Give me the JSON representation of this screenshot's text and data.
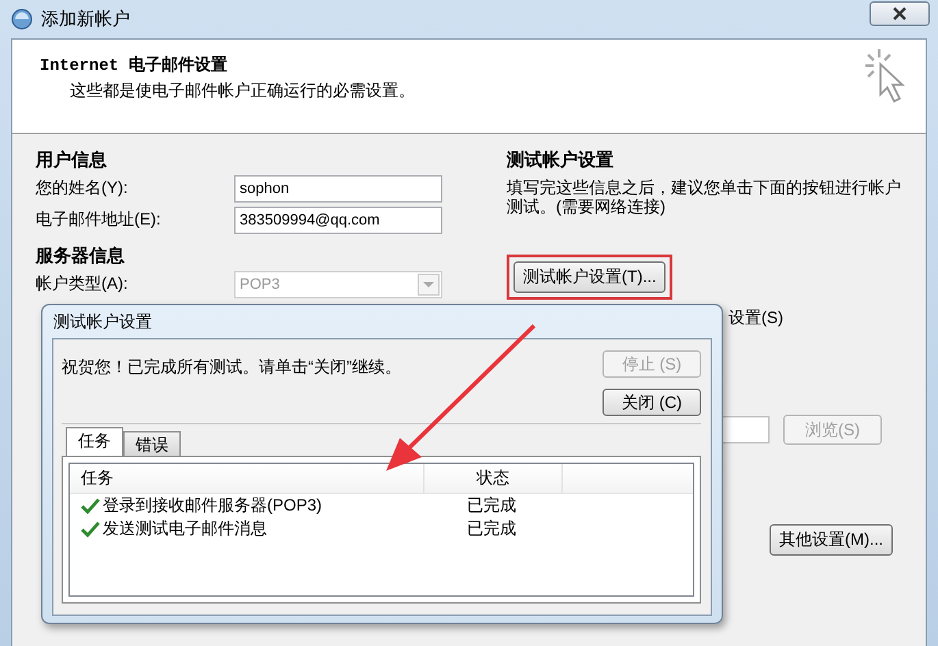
{
  "window": {
    "title": "添加新帐户"
  },
  "header": {
    "title": "Internet 电子邮件设置",
    "subtitle": "这些都是使电子邮件帐户正确运行的必需设置。"
  },
  "user_info": {
    "heading": "用户信息",
    "fields": [
      {
        "label": "您的姓名(Y):",
        "value": "sophon"
      },
      {
        "label": "电子邮件地址(E):",
        "value": "383509994@qq.com"
      }
    ]
  },
  "server_info": {
    "heading": "服务器信息",
    "account_type": {
      "label": "帐户类型(A):",
      "value": "POP3",
      "disabled": true
    }
  },
  "test_settings": {
    "heading": "测试帐户设置",
    "description": "填写完这些信息之后，建议您单击下面的按钮进行帐户测试。(需要网络连接)",
    "button": "测试帐户设置(T)...",
    "highlighted": true
  },
  "partial_option": "设置(S)",
  "browse_button": {
    "label": "浏览(S)",
    "disabled": true
  },
  "more_settings_button": "其他设置(M)...",
  "dialog": {
    "title": "测试帐户设置",
    "message": "祝贺您！已完成所有测试。请单击“关闭”继续。",
    "buttons": [
      {
        "label": "停止 (S)",
        "disabled": true
      },
      {
        "label": "关闭 (C)",
        "disabled": false
      }
    ],
    "tabs": [
      {
        "label": "任务",
        "selected": true
      },
      {
        "label": "错误",
        "selected": false
      }
    ],
    "table": {
      "columns": [
        "任务",
        "状态"
      ],
      "rows": [
        {
          "task": "登录到接收邮件服务器(POP3)",
          "status": "已完成",
          "done": true
        },
        {
          "task": "发送测试电子邮件消息",
          "status": "已完成",
          "done": true
        }
      ]
    }
  }
}
